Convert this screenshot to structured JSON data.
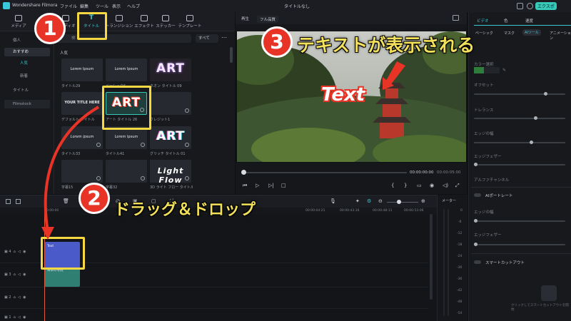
{
  "titlebar": {
    "app_name": "Wondershare Filmora",
    "menus": [
      "ファイル",
      "編集",
      "ツール",
      "表示",
      "ヘルプ"
    ],
    "document_title": "タイトルなし",
    "plan_badge": "エクスポ"
  },
  "library": {
    "tabs": [
      {
        "label": "メディア",
        "icon": "media-icon"
      },
      {
        "label": "オーディオ",
        "icon": "audio-icon"
      },
      {
        "label": "タイトル",
        "icon": "title-T-icon"
      },
      {
        "label": "トランジション",
        "icon": "transition-icon"
      },
      {
        "label": "エフェクト",
        "icon": "effect-icon"
      },
      {
        "label": "ステッカー",
        "icon": "sticker-icon"
      },
      {
        "label": "テンプレート",
        "icon": "template-icon"
      }
    ],
    "sidebar": [
      "個人",
      "おすすめ",
      "人気",
      "新着",
      "タイトル",
      "Filmstock"
    ],
    "search_placeholder": "検",
    "filter_label": "すべて",
    "section_label": "人気",
    "thumbnails": [
      {
        "label": "タイトル29",
        "text": "Lorem Ipsum"
      },
      {
        "label": "ベーシック6",
        "text": "Lorem Ipsum"
      },
      {
        "label": "ネオン タイトル 09",
        "text": "ART"
      },
      {
        "label": "デフォルト タイトル",
        "text": "YOUR TITLE HERE"
      },
      {
        "label": "アート タイトル 26",
        "text": "ART"
      },
      {
        "label": "クレジット1",
        "text": ""
      },
      {
        "label": "タイトル33",
        "text": "Lorem ipsum"
      },
      {
        "label": "タイトル41",
        "text": "Lorem Ipsum"
      },
      {
        "label": "グリッチ タイトル 01",
        "text": "ART"
      },
      {
        "label": "字幕15",
        "text": ""
      },
      {
        "label": "字幕32",
        "text": ""
      },
      {
        "label": "3D ライト フロー タイトル",
        "text": "Light Flow"
      }
    ]
  },
  "preview": {
    "play_label": "再生",
    "quality_label": "フル品質",
    "overlay_text": "Text",
    "current_time": "00:00:00:00",
    "total_time": "00:00:05:00"
  },
  "inspector": {
    "tabs": [
      "ビデオ",
      "色",
      "速度"
    ],
    "subtabs": [
      "ベーシック",
      "マスク",
      "AIツール",
      "アニメーション"
    ],
    "labels": [
      "カラー選択",
      "オフセット",
      "トレランス",
      "エッジの幅",
      "エッジフェザー",
      "アルファチャンネル",
      "AIポートレート",
      "エッジの幅",
      "エッジフェザー",
      "スマートカットアウト"
    ],
    "smart_cutout_hint": "クリックしてスマートカットアウトを開始"
  },
  "timeline": {
    "timecodes": [
      "00:00:00",
      "00:00:04:21",
      "00:00:43:16",
      "00:00:48:11",
      "00:00:53:06"
    ],
    "clip_title_label": "Text",
    "clip_video_label": "日本の寺院",
    "track_names": [
      "4",
      "3",
      "2",
      "1"
    ],
    "meter_label": "メーター",
    "meter_ticks": [
      "0",
      "-6",
      "-12",
      "-18",
      "-24",
      "-30",
      "-36",
      "-42",
      "-48",
      "-54"
    ]
  },
  "annotations": {
    "step1_number": "1",
    "step2_number": "2",
    "step2_text": "ドラッグ＆ドロップ",
    "step3_number": "3",
    "step3_text": "テキストが表示される"
  },
  "colors": {
    "accent": "#3cc9d6",
    "callout_red": "#e83426",
    "callout_yellow": "#f2e05a",
    "highlight_box": "#f5d842"
  }
}
